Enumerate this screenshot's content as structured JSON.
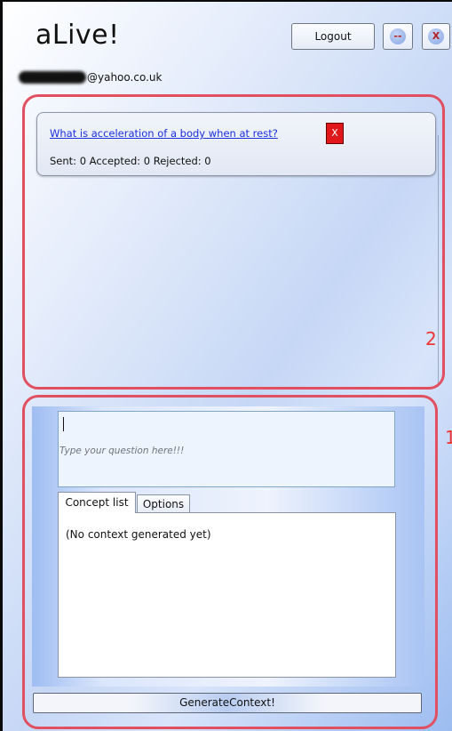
{
  "app": {
    "title": "aLive!"
  },
  "header": {
    "logout_label": "Logout",
    "minimize_label": "--",
    "close_label": "X"
  },
  "user": {
    "email_visible": "@yahoo.co.uk"
  },
  "questions": [
    {
      "text": "What is acceleration of a body when at rest?",
      "stats": "Sent: 0 Accepted: 0 Rejected: 0",
      "remove_label": "X"
    }
  ],
  "annotations": {
    "region_2": "2",
    "region_1": "1"
  },
  "compose": {
    "placeholder": "Type your question here!!!",
    "tabs": [
      "Concept list",
      "Options"
    ],
    "context_text": "(No context generated yet)",
    "generate_label": "GenerateContext!"
  },
  "colors": {
    "annotation_red": "#e05060",
    "link_blue": "#1b2ee0",
    "remove_red": "#e0181a"
  }
}
